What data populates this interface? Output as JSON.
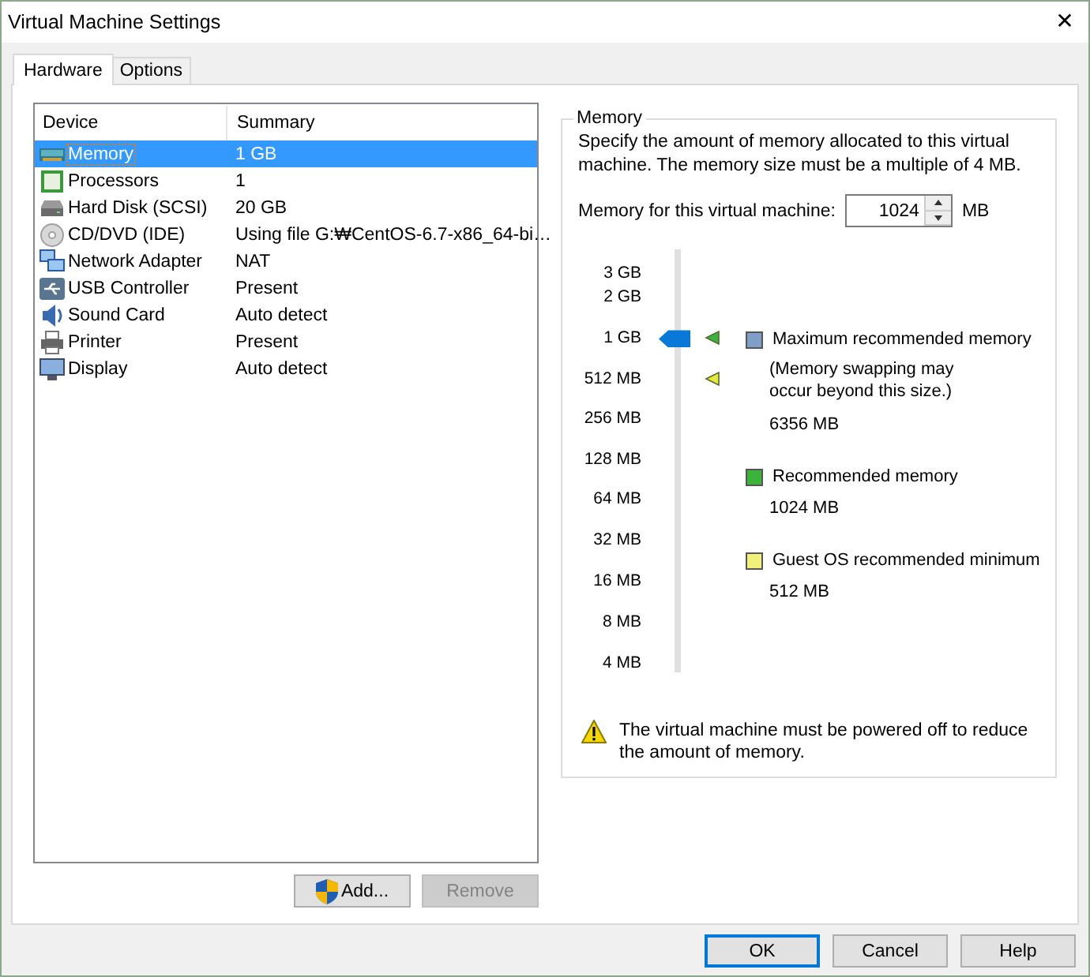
{
  "window": {
    "title": "Virtual Machine Settings",
    "close": "✕"
  },
  "tabs": [
    {
      "label": "Hardware",
      "selected": true
    },
    {
      "label": "Options",
      "selected": false
    }
  ],
  "device_list": {
    "columns": [
      "Device",
      "Summary"
    ],
    "rows": [
      {
        "kind": "memory",
        "device": "Memory",
        "summary": "1 GB",
        "selected": true
      },
      {
        "kind": "cpu",
        "device": "Processors",
        "summary": "1",
        "selected": false
      },
      {
        "kind": "disk",
        "device": "Hard Disk (SCSI)",
        "summary": "20 GB",
        "selected": false
      },
      {
        "kind": "cd",
        "device": "CD/DVD (IDE)",
        "summary": "Using file G:₩CentOS-6.7-x86_64-bi…",
        "selected": false
      },
      {
        "kind": "network",
        "device": "Network Adapter",
        "summary": "NAT",
        "selected": false
      },
      {
        "kind": "usb",
        "device": "USB Controller",
        "summary": "Present",
        "selected": false
      },
      {
        "kind": "sound",
        "device": "Sound Card",
        "summary": "Auto detect",
        "selected": false
      },
      {
        "kind": "printer",
        "device": "Printer",
        "summary": "Present",
        "selected": false
      },
      {
        "kind": "display",
        "device": "Display",
        "summary": "Auto detect",
        "selected": false
      }
    ]
  },
  "list_buttons": [
    {
      "label": "Add...",
      "disabled": false,
      "shield": true
    },
    {
      "label": "Remove",
      "disabled": true,
      "shield": false
    }
  ],
  "memory": {
    "title": "Memory",
    "description": "Specify the amount of memory allocated to this virtual machine. The memory size must be a multiple of 4 MB.",
    "field_label": "Memory for this virtual machine:",
    "value": "1024",
    "unit": "MB",
    "slider": {
      "level": 0.79,
      "ticks": [
        {
          "label": "3 GB"
        },
        {
          "label": "2 GB"
        },
        {
          "label": "1 GB",
          "color": "#3cb43c"
        },
        {
          "label": "512 MB",
          "color": "#e8e83c"
        },
        {
          "label": "256 MB"
        },
        {
          "label": "128 MB"
        },
        {
          "label": "64 MB"
        },
        {
          "label": "32 MB"
        },
        {
          "label": "16 MB"
        },
        {
          "label": "8 MB"
        },
        {
          "label": "4 MB"
        }
      ]
    },
    "legend": [
      {
        "color": "#7f9fc6",
        "title": "Maximum recommended memory",
        "note": "(Memory swapping may occur beyond this size.)",
        "value": "6356 MB"
      },
      {
        "color": "#3cb43c",
        "title": "Recommended memory",
        "value": "1024 MB"
      },
      {
        "color": "#f0f07a",
        "title": "Guest OS recommended minimum",
        "value": "512 MB"
      }
    ],
    "warning": "The virtual machine must be powered off to reduce the amount of memory."
  },
  "buttons": [
    {
      "label": "OK",
      "default": true
    },
    {
      "label": "Cancel",
      "default": false
    },
    {
      "label": "Help",
      "default": false
    }
  ]
}
